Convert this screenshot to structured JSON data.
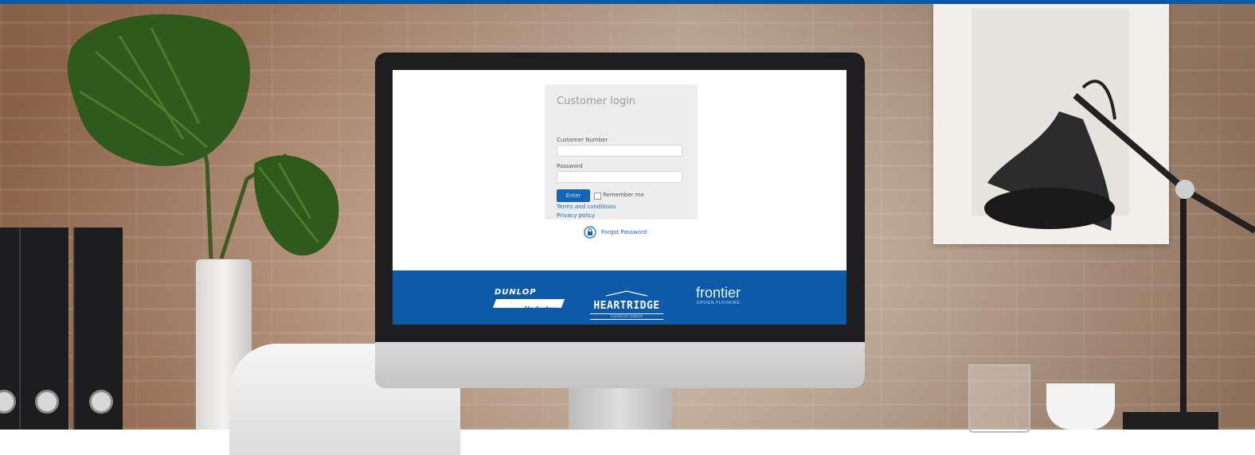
{
  "login": {
    "title": "Customer login",
    "customer_number_label": "Customer Number",
    "customer_number_value": "",
    "password_label": "Password",
    "password_value": "",
    "enter_button": "Enter",
    "remember_me": "Remember me",
    "terms_link": "Terms and conditions",
    "privacy_link": "Privacy policy",
    "forgot_password": "Forgot Password"
  },
  "brands": {
    "dunlop_name": "DUNLOP",
    "dunlop_sub": "Underlay",
    "heartridge_name": "HEARTRIDGE",
    "heartridge_sub": "FLOORS BY DUNLOP",
    "frontier_name": "frontier",
    "frontier_sub": "DESIGN FLOORING"
  },
  "colors": {
    "accent": "#0c5aa8",
    "button": "#1565b7",
    "link": "#1565b7",
    "login_panel": "#ededed"
  },
  "icons": {
    "forgot_password": "padlock-refresh-icon"
  }
}
